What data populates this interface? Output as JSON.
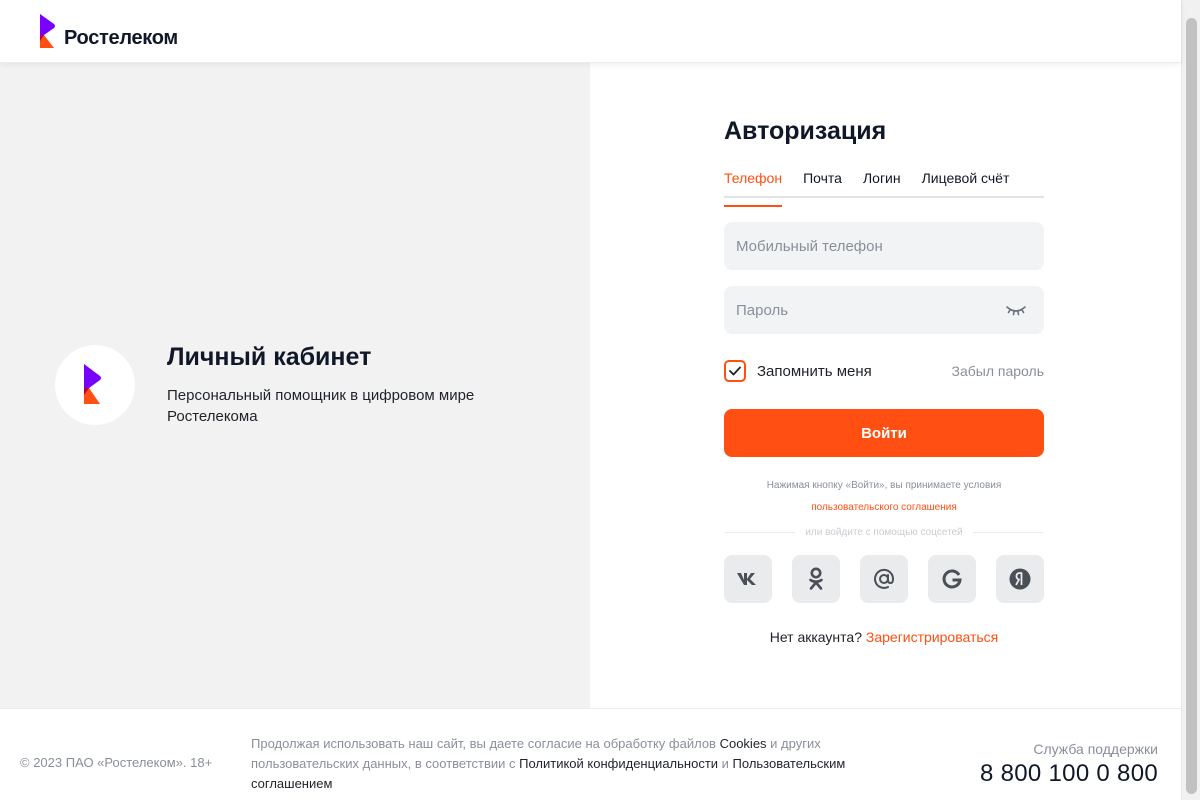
{
  "header": {
    "brand_name": "Ростелеком"
  },
  "promo": {
    "title": "Личный кабинет",
    "description": "Персональный помощник в цифровом мире Ростелекома"
  },
  "auth": {
    "title": "Авторизация",
    "tabs": [
      {
        "label": "Телефон",
        "active": true
      },
      {
        "label": "Почта",
        "active": false
      },
      {
        "label": "Логин",
        "active": false
      },
      {
        "label": "Лицевой счёт",
        "active": false
      }
    ],
    "phone_placeholder": "Мобильный телефон",
    "password_placeholder": "Пароль",
    "remember_label": "Запомнить меня",
    "remember_checked": true,
    "forgot_label": "Забыл пароль",
    "login_label": "Войти",
    "terms_text": "Нажимая кнопку «Войти», вы принимаете условия",
    "terms_link": "пользовательского соглашения",
    "social_divider": "или войдите с помощью соцсетей",
    "socials": [
      {
        "name": "vk-icon",
        "label": "VK"
      },
      {
        "name": "ok-icon",
        "label": "Одноклассники"
      },
      {
        "name": "mail-icon",
        "label": "@"
      },
      {
        "name": "google-icon",
        "label": "G"
      },
      {
        "name": "yandex-icon",
        "label": "Я"
      }
    ],
    "no_account_text": "Нет аккаунта?",
    "register_label": "Зарегистрироваться"
  },
  "footer": {
    "copyright": "© 2023 ПАО «Ростелеком». 18+",
    "cookie_part1": "Продолжая использовать наш сайт, вы даете согласие на обработку файлов ",
    "cookie_link1": "Cookies",
    "cookie_part2": " и других пользовательских данных, в соответствии с ",
    "cookie_link2": "Политикой конфиденциальности",
    "cookie_part3": " и ",
    "cookie_link3": "Пользовательским соглашением",
    "support_label": "Служба поддержки",
    "support_phone": "8 800 100 0 800"
  },
  "colors": {
    "accent": "#ff4f12",
    "brand_purple": "#7700ff",
    "left_panel_bg": "#f2f2f2",
    "input_bg": "#f2f3f5"
  }
}
